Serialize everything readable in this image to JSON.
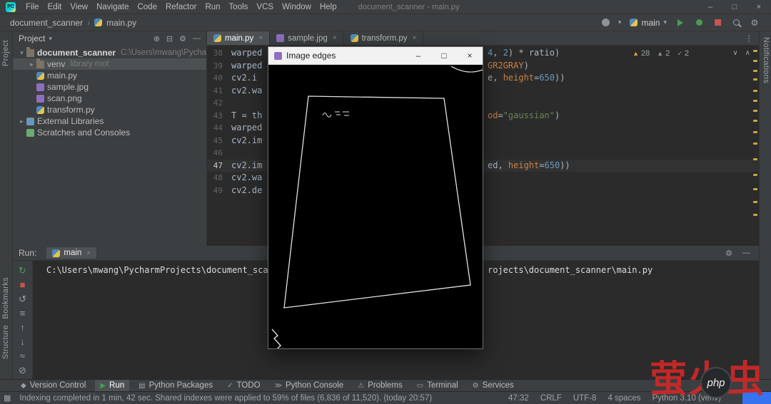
{
  "colors": {
    "warning_yellow": "#c9a742",
    "run_green": "#499c54",
    "stop_red": "#c75450",
    "selection_grey": "#4c5052",
    "accent_blue": "#3573f0",
    "watermark_red": "#d23a3a"
  },
  "icons": {
    "logo": "PC",
    "chevron_down": "▾",
    "breadcrumb_sep": "›",
    "tree_expanded": "▾",
    "tree_collapsed": "▸",
    "close": "×",
    "minimize": "–",
    "maximize": "□",
    "more": "⋮",
    "gear": "⚙",
    "target": "⊕",
    "collapse_all": "⊟",
    "hide": "—",
    "warning": "▲",
    "check": "✓",
    "nav_up": "∧",
    "nav_down": "∨",
    "grid": "▦"
  },
  "title_bar": {
    "menus": [
      "File",
      "Edit",
      "View",
      "Navigate",
      "Code",
      "Refactor",
      "Run",
      "Tools",
      "VCS",
      "Window",
      "Help"
    ],
    "title": "document_scanner - main.py"
  },
  "toolbar": {
    "breadcrumbs": [
      "document_scanner",
      "main.py"
    ],
    "run_config": "main",
    "actions": [
      {
        "name": "run",
        "type": "play"
      },
      {
        "name": "debug",
        "type": "dot"
      },
      {
        "name": "stop",
        "type": "square"
      },
      {
        "name": "search-everywhere",
        "type": "magnifier"
      },
      {
        "name": "settings",
        "type": "gear"
      }
    ]
  },
  "project_panel": {
    "header": "Project",
    "tree": [
      {
        "label": "document_scanner",
        "hint": "C:\\Users\\mwang\\PycharmProjects",
        "icon": "folder",
        "state": "expanded",
        "indent": 0,
        "bold": true,
        "selected": false
      },
      {
        "label": "venv",
        "hint": "library root",
        "icon": "folder",
        "state": "collapsed",
        "indent": 1,
        "bold": false,
        "selected": true
      },
      {
        "label": "main.py",
        "hint": "",
        "icon": "python",
        "state": "none",
        "indent": 1,
        "bold": false,
        "selected": false
      },
      {
        "label": "sample.jpg",
        "hint": "",
        "icon": "image",
        "state": "none",
        "indent": 1,
        "bold": false,
        "selected": false
      },
      {
        "label": "scan.png",
        "hint": "",
        "icon": "image",
        "state": "none",
        "indent": 1,
        "bold": false,
        "selected": false
      },
      {
        "label": "transform.py",
        "hint": "",
        "icon": "python",
        "state": "none",
        "indent": 1,
        "bold": false,
        "selected": false
      },
      {
        "label": "External Libraries",
        "hint": "",
        "icon": "library",
        "state": "collapsed",
        "indent": 0,
        "bold": false,
        "selected": false
      },
      {
        "label": "Scratches and Consoles",
        "hint": "",
        "icon": "scratch",
        "state": "none",
        "indent": 0,
        "bold": false,
        "selected": false
      }
    ]
  },
  "editor": {
    "tabs": [
      {
        "label": "main.py",
        "icon": "python",
        "active": true
      },
      {
        "label": "sample.jpg",
        "icon": "image",
        "active": false
      },
      {
        "label": "transform.py",
        "icon": "python",
        "active": false
      }
    ],
    "inspections": [
      {
        "icon": "warning",
        "color": "#d9a343",
        "count": "28"
      },
      {
        "icon": "warning",
        "color": "#8e9396",
        "count": "2"
      },
      {
        "icon": "check",
        "color": "#8e9396",
        "count": "2"
      }
    ],
    "lines": [
      {
        "num": "38",
        "left": "warped",
        "right": [
          [
            "4",
            "n"
          ],
          [
            ", ",
            "d"
          ],
          [
            "2",
            "n"
          ],
          [
            ") * ratio)",
            "d"
          ]
        ],
        "current": false
      },
      {
        "num": "39",
        "left": "warped",
        "right": [
          [
            "GR2GRAY",
            "k"
          ],
          [
            ")",
            "d"
          ]
        ],
        "current": false
      },
      {
        "num": "40",
        "left": "cv2.i",
        "right": [
          [
            "e, ",
            "d"
          ],
          [
            "height",
            "k"
          ],
          [
            "=",
            "d"
          ],
          [
            "650",
            "n"
          ],
          [
            "))",
            "d"
          ]
        ],
        "current": false
      },
      {
        "num": "41",
        "left": "cv2.wa",
        "right": [],
        "current": false
      },
      {
        "num": "42",
        "left": "",
        "right": [],
        "current": false
      },
      {
        "num": "43",
        "left": "T = th",
        "right": [
          [
            "od",
            "k"
          ],
          [
            "=",
            "d"
          ],
          [
            "\"gaussian\"",
            "s"
          ],
          [
            ")",
            "d"
          ]
        ],
        "current": false
      },
      {
        "num": "44",
        "left": "warped",
        "right": [],
        "current": false
      },
      {
        "num": "45",
        "left": "cv2.im",
        "right": [],
        "current": false
      },
      {
        "num": "46",
        "left": "",
        "right": [],
        "current": false
      },
      {
        "num": "47",
        "left": "cv2.im",
        "right": [
          [
            "ed, ",
            "d"
          ],
          [
            "height",
            "k"
          ],
          [
            "=",
            "d"
          ],
          [
            "650",
            "n"
          ],
          [
            "))",
            "d"
          ]
        ],
        "current": true
      },
      {
        "num": "48",
        "left": "cv2.wa",
        "right": [],
        "current": false
      },
      {
        "num": "49",
        "left": "cv2.de",
        "right": [],
        "current": false
      }
    ],
    "scroll_marks": [
      6,
      20,
      34,
      46,
      62,
      76,
      90,
      104,
      120,
      136,
      158,
      180,
      200,
      218,
      236
    ]
  },
  "image_window": {
    "title": "Image edges"
  },
  "run_panel": {
    "label": "Run:",
    "tab": "main",
    "icons": [
      {
        "name": "rerun",
        "glyph": "↻",
        "color": "#499c54"
      },
      {
        "name": "stop",
        "glyph": "■",
        "color": "#c75450"
      },
      {
        "name": "restore-layout",
        "glyph": "↺",
        "color": "#9aa0a6"
      },
      {
        "name": "history",
        "glyph": "≡",
        "color": "#9aa0a6"
      },
      {
        "name": "scroll-up",
        "glyph": "↑",
        "color": "#9aa0a6"
      },
      {
        "name": "scroll-down",
        "glyph": "↓",
        "color": "#9aa0a6"
      },
      {
        "name": "soft-wrap",
        "glyph": "≈",
        "color": "#9aa0a6"
      },
      {
        "name": "clear-all",
        "glyph": "⊘",
        "color": "#9aa0a6"
      }
    ],
    "console_left": "C:\\Users\\mwang\\PycharmProjects\\document_scanner\\",
    "console_right": "rojects\\document_scanner\\main.py"
  },
  "tool_buttons": [
    {
      "label": "Version Control",
      "glyph": "◆",
      "active": false,
      "color": ""
    },
    {
      "label": "Run",
      "glyph": "▶",
      "active": true,
      "color": "#499c54"
    },
    {
      "label": "Python Packages",
      "glyph": "▤",
      "active": false,
      "color": ""
    },
    {
      "label": "TODO",
      "glyph": "✓",
      "active": false,
      "color": ""
    },
    {
      "label": "Python Console",
      "glyph": "≫",
      "active": false,
      "color": ""
    },
    {
      "label": "Problems",
      "glyph": "⚠",
      "active": false,
      "color": ""
    },
    {
      "label": "Terminal",
      "glyph": "▭",
      "active": false,
      "color": ""
    },
    {
      "label": "Services",
      "glyph": "⚙",
      "active": false,
      "color": ""
    }
  ],
  "status_bar": {
    "message": "Indexing completed in 1 min, 42 sec. Shared indexes were applied to 59% of files (6,836 of 11,520). (today 20:57)",
    "position": "47:32",
    "line_sep": "CRLF",
    "encoding": "UTF-8",
    "indent": "4 spaces",
    "interpreter": "Python 3.10 (venv)"
  },
  "stripes": {
    "left": [
      "Project",
      "Bookmarks",
      "Structure"
    ],
    "right": [
      "Notifications"
    ]
  },
  "watermark": {
    "text": "萤火虫",
    "badge": "php"
  }
}
